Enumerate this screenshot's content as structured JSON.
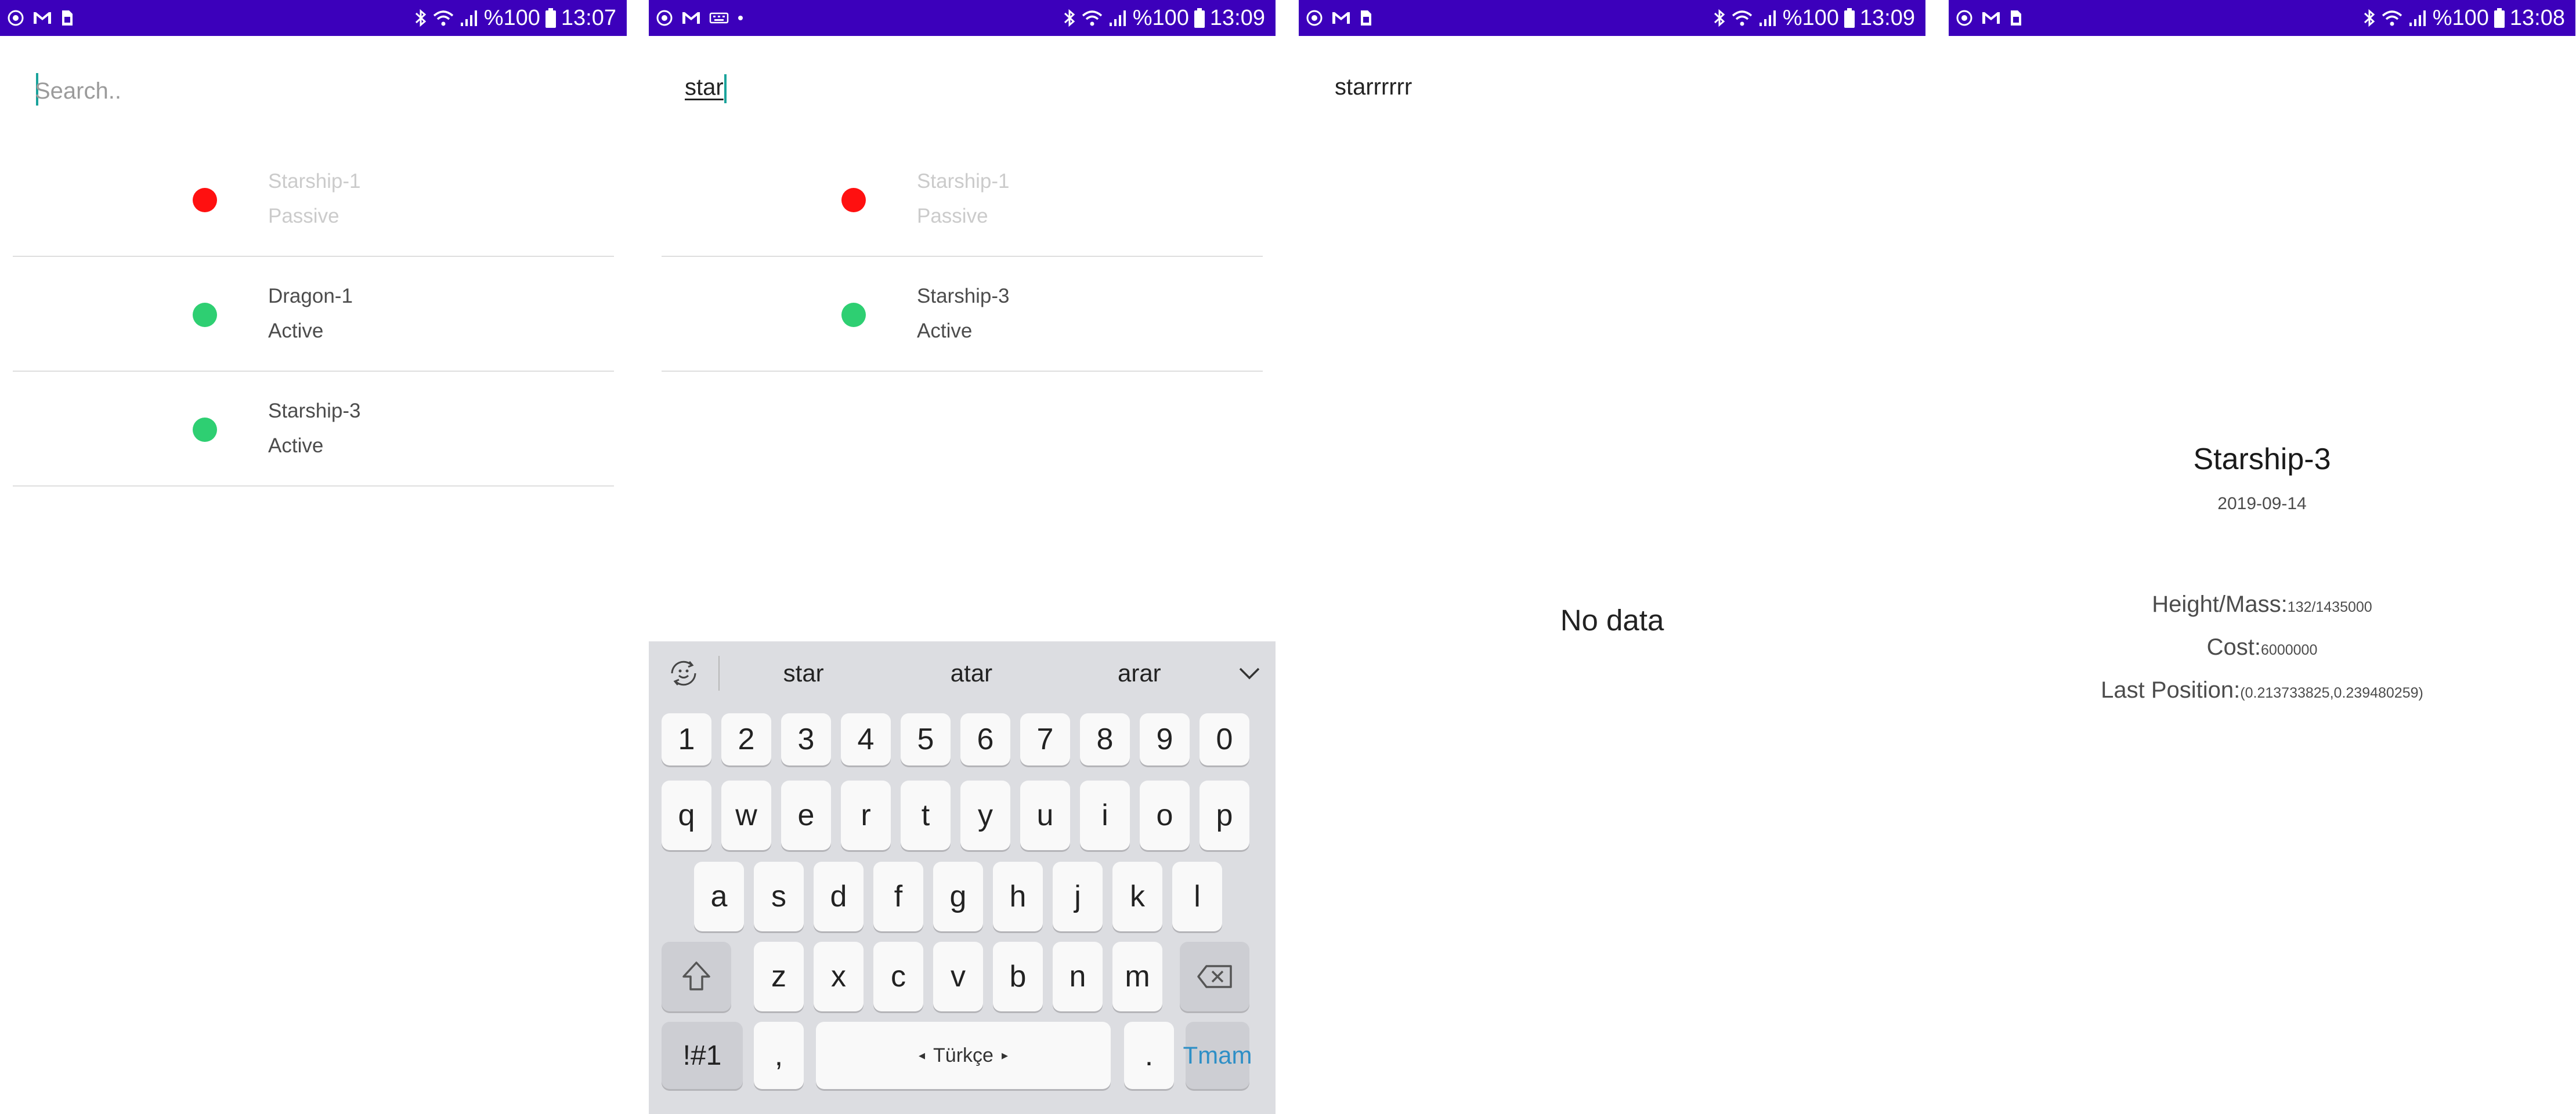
{
  "status_bar": {
    "left_icons": [
      "record-icon",
      "gmail-icon",
      "sim-icon"
    ],
    "battery_label": "%100",
    "times": [
      "13:07",
      "13:09",
      "13:09",
      "13:08"
    ]
  },
  "screen1": {
    "search": {
      "value": "",
      "placeholder": "Search.."
    },
    "items": [
      {
        "name": "Starship-1",
        "status": "Passive",
        "state": "passive"
      },
      {
        "name": "Dragon-1",
        "status": "Active",
        "state": "active"
      },
      {
        "name": "Starship-3",
        "status": "Active",
        "state": "active"
      }
    ]
  },
  "screen2": {
    "search": {
      "value": "star"
    },
    "items": [
      {
        "name": "Starship-1",
        "status": "Passive",
        "state": "passive"
      },
      {
        "name": "Starship-3",
        "status": "Active",
        "state": "active"
      }
    ],
    "keyboard": {
      "suggestions": [
        "star",
        "atar",
        "arar"
      ],
      "number_row": [
        "1",
        "2",
        "3",
        "4",
        "5",
        "6",
        "7",
        "8",
        "9",
        "0"
      ],
      "row1": [
        "q",
        "w",
        "e",
        "r",
        "t",
        "y",
        "u",
        "i",
        "o",
        "p"
      ],
      "row2": [
        "a",
        "s",
        "d",
        "f",
        "g",
        "h",
        "j",
        "k",
        "l"
      ],
      "row3": [
        "z",
        "x",
        "c",
        "v",
        "b",
        "n",
        "m"
      ],
      "symbols_label": "!#1",
      "comma_label": ",",
      "space_label": "Türkçe",
      "period_label": ".",
      "done_label": "Tmam"
    }
  },
  "screen3": {
    "search": {
      "value": "starrrrrr"
    },
    "empty_label": "No data"
  },
  "screen4": {
    "title": "Starship-3",
    "date": "2019-09-14",
    "height_mass_label": "Height/Mass:",
    "height_mass_value": "132/1435000",
    "cost_label": "Cost:",
    "cost_value": "6000000",
    "position_label": "Last Position:",
    "position_value": "(0.213733825,0.239480259)"
  },
  "colors": {
    "status_bar": "#3c00bb",
    "passive_dot": "#ff1010",
    "active_dot": "#2ecf72",
    "caret": "#1aa39b",
    "keyboard_bg": "#dcdde1",
    "done_key_text": "#2e8fc6"
  }
}
